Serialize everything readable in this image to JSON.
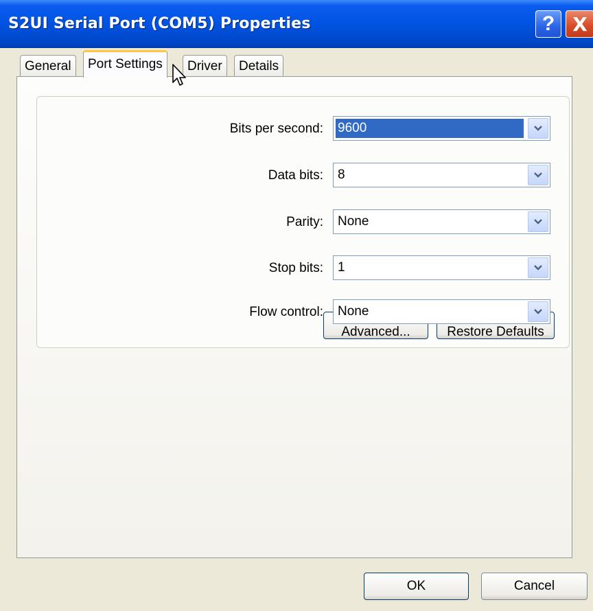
{
  "window": {
    "title": "S2UI Serial Port (COM5) Properties"
  },
  "title_buttons": {
    "help": "?",
    "close": "X"
  },
  "tabs": [
    {
      "label": "General",
      "active": false
    },
    {
      "label": "Port Settings",
      "active": true
    },
    {
      "label": "Driver",
      "active": false
    },
    {
      "label": "Details",
      "active": false
    }
  ],
  "settings": {
    "bits_per_second": {
      "label": "Bits per second:",
      "value": "9600"
    },
    "data_bits": {
      "label": "Data bits:",
      "value": "8"
    },
    "parity": {
      "label": "Parity:",
      "value": "None"
    },
    "stop_bits": {
      "label": "Stop bits:",
      "value": "1"
    },
    "flow_control": {
      "label": "Flow control:",
      "value": "None"
    }
  },
  "panel_buttons": {
    "advanced": "Advanced...",
    "restore": "Restore Defaults"
  },
  "dialog_buttons": {
    "ok": "OK",
    "cancel": "Cancel"
  },
  "colors": {
    "titlebar": "#0053e1",
    "selection": "#316ac5",
    "tab_highlight": "#ffc83c"
  }
}
